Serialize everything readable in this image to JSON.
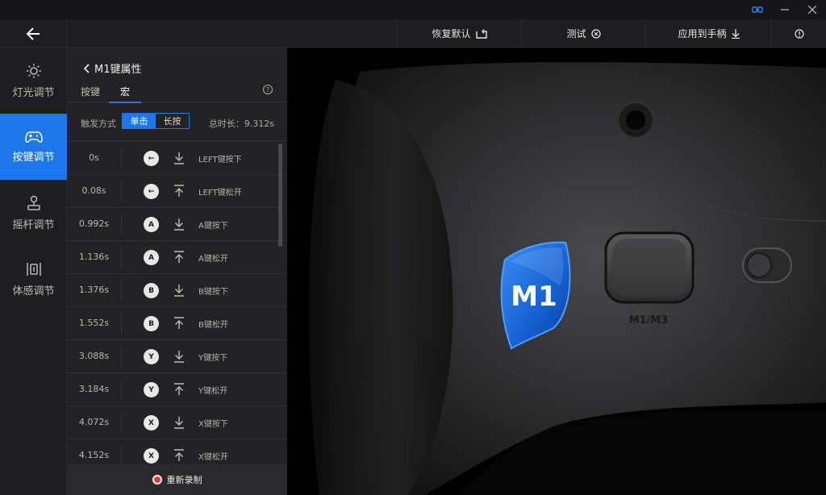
{
  "toolbar": {
    "restore_default": "恢复默认",
    "test": "测试",
    "apply_to_controller": "应用到手柄"
  },
  "nav": {
    "items": [
      {
        "label": "灯光调节",
        "icon": "sun-icon"
      },
      {
        "label": "按键调节",
        "icon": "gamepad-icon"
      },
      {
        "label": "摇杆调节",
        "icon": "joystick-icon"
      },
      {
        "label": "体感调节",
        "icon": "motion-icon"
      }
    ],
    "active_index": 1
  },
  "panel": {
    "title": "M1键属性",
    "tabs": [
      "按键",
      "宏"
    ],
    "active_tab": 1,
    "trigger_label": "触发方式",
    "trigger_options": [
      "单击",
      "长按"
    ],
    "trigger_selected": 0,
    "total_label": "总时长：9.312s",
    "rerecord_label": "重新录制"
  },
  "macro_rows": [
    {
      "time": "0s",
      "key": "←",
      "dir": "down",
      "action": "LEFT键按下"
    },
    {
      "time": "0.08s",
      "key": "←",
      "dir": "up",
      "action": "LEFT键松开"
    },
    {
      "time": "0.992s",
      "key": "A",
      "dir": "down",
      "action": "A键按下"
    },
    {
      "time": "1.136s",
      "key": "A",
      "dir": "up",
      "action": "A键松开"
    },
    {
      "time": "1.376s",
      "key": "B",
      "dir": "down",
      "action": "B键按下"
    },
    {
      "time": "1.552s",
      "key": "B",
      "dir": "up",
      "action": "B键松开"
    },
    {
      "time": "3.088s",
      "key": "Y",
      "dir": "down",
      "action": "Y键按下"
    },
    {
      "time": "3.184s",
      "key": "Y",
      "dir": "up",
      "action": "Y键松开"
    },
    {
      "time": "4.072s",
      "key": "X",
      "dir": "down",
      "action": "X键按下"
    },
    {
      "time": "4.152s",
      "key": "X",
      "dir": "up",
      "action": "X键松开"
    }
  ],
  "preview": {
    "badge": "M1",
    "switch_label": "M1/M3"
  },
  "colors": {
    "accent": "#1c78ea",
    "background": "#1b1b1d",
    "record": "#e53935"
  }
}
